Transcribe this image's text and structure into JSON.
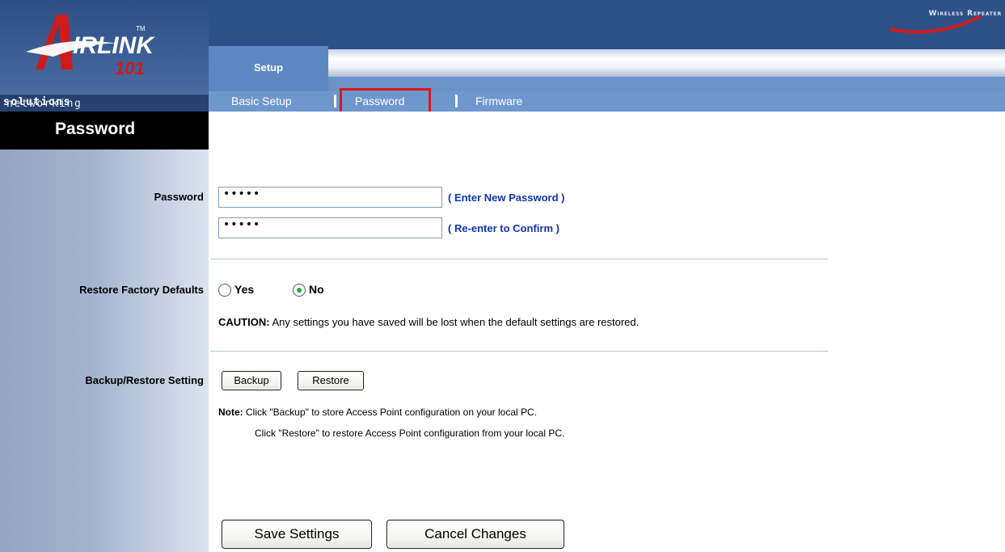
{
  "brand": {
    "logo_text": "AIRLINK",
    "logo_number": "101",
    "tagline_part1": "networking",
    "tagline_part2": "solutions",
    "product_name": "Wireless Repeater"
  },
  "tabs": {
    "main": "Setup",
    "sub": [
      "Basic Setup",
      "Password",
      "Firmware"
    ],
    "active_sub": "Password"
  },
  "sidebar": {
    "section_title": "Password",
    "labels": {
      "password": "Password",
      "restore": "Restore Factory Defaults",
      "backup": "Backup/Restore Setting"
    }
  },
  "password": {
    "value": "•••••",
    "confirm_value": "•••••",
    "hint": "( Enter New Password )",
    "confirm_hint": "( Re-enter to Confirm )"
  },
  "restore": {
    "yes_label": "Yes",
    "no_label": "No",
    "selected": "No",
    "caution_label": "CAUTION:",
    "caution_text": " Any settings you have saved will be lost when the default settings are restored."
  },
  "backup": {
    "backup_label": "Backup",
    "restore_label": "Restore",
    "note_label": "Note:",
    "note_line1": " Click \"Backup\" to store Access Point configuration on your local PC.",
    "note_line2": "Click \"Restore\" to restore Access Point configuration from your local PC."
  },
  "actions": {
    "save": "Save Settings",
    "cancel": "Cancel Changes"
  },
  "colors": {
    "header_blue": "#2d4f86",
    "tab_blue": "#5d87c1",
    "subnav_blue": "#6e97ce",
    "hint_blue": "#1033b8",
    "highlight_red": "#e0141e",
    "radio_selected": "#25a83a"
  }
}
